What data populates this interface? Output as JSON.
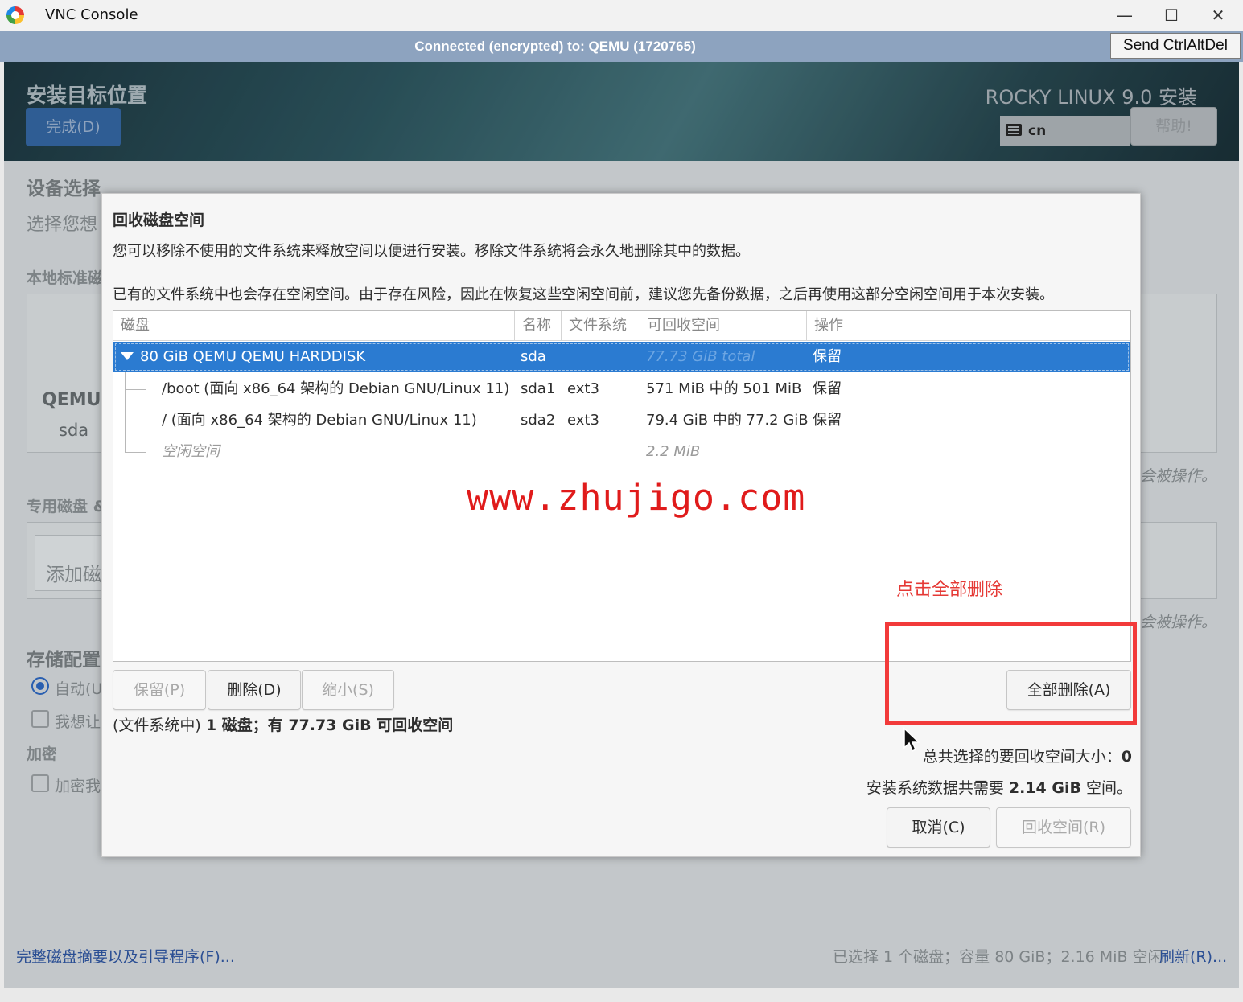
{
  "window": {
    "title": "VNC Console",
    "minimize": "—",
    "maximize": "☐",
    "close": "✕"
  },
  "vnc": {
    "status": "Connected (encrypted) to: QEMU (1720765)",
    "send_ctrlaltdel": "Send CtrlAltDel"
  },
  "installer": {
    "spoke_title": "安装目标位置",
    "done_button": "完成(D)",
    "product_title": "ROCKY LINUX 9.0 安装",
    "keyboard_layout": "cn",
    "help_button": "帮助!",
    "background": {
      "device_selection": "设备选择",
      "select_prompt": "选择您想",
      "local_disks": "本地标准磁",
      "disk_model": "QEMU",
      "disk_name": "sda",
      "disk_note_1": "会被操作。",
      "specialized": "专用磁盘 &",
      "add_disk": "添加磁",
      "disk_note_2": "会被操作。",
      "storage_config": "存储配置",
      "auto": "自动(U",
      "custom": "我想让",
      "encryption": "加密",
      "encrypt": "加密我",
      "summary_link": "完整磁盘摘要以及引导程序(F)...",
      "status": "已选择 1 个磁盘；容量 80 GiB；2.16 MiB 空闲",
      "refresh_link": "刷新(R)..."
    }
  },
  "dialog": {
    "title": "回收磁盘空间",
    "desc1": "您可以移除不使用的文件系统来释放空间以便进行安装。移除文件系统将会永久地删除其中的数据。",
    "desc2": "已有的文件系统中也会存在空闲空间。由于存在风险，因此在恢复这些空闲空间前，建议您先备份数据，之后再使用这部分空闲空间用于本次安装。",
    "columns": [
      "磁盘",
      "名称",
      "文件系统",
      "可回收空间",
      "操作"
    ],
    "rows": [
      {
        "disk": "80 GiB QEMU QEMU HARDDISK",
        "name": "sda",
        "fs": "",
        "reclaim": "77.73 GiB total",
        "action": "保留"
      },
      {
        "disk": "/boot (面向 x86_64 架构的 Debian GNU/Linux 11)",
        "name": "sda1",
        "fs": "ext3",
        "reclaim": "571 MiB 中的 501 MiB",
        "action": "保留"
      },
      {
        "disk": "/ (面向 x86_64 架构的 Debian GNU/Linux 11)",
        "name": "sda2",
        "fs": "ext3",
        "reclaim": "79.4 GiB 中的 77.2 GiB",
        "action": "保留"
      },
      {
        "disk": "空闲空间",
        "name": "",
        "fs": "",
        "reclaim": "2.2 MiB",
        "action": ""
      }
    ],
    "buttons": {
      "preserve": "保留(P)",
      "delete": "删除(D)",
      "shrink": "缩小(S)",
      "delete_all": "全部删除(A)",
      "cancel": "取消(C)",
      "reclaim": "回收空间(R)"
    },
    "summary_prefix": "(文件系统中) ",
    "summary_bold": "1 磁盘；有 77.73 GiB 可回收空间",
    "selected_label": "总共选择的要回收空间大小：",
    "selected_value": "0",
    "need_prefix": "安装系统数据共需要 ",
    "need_value": "2.14 GiB",
    "need_suffix": " 空间。"
  },
  "overlay": {
    "watermark": "www.zhujigo.com",
    "annotation": "点击全部删除",
    "annotation_color": "#e53935"
  }
}
